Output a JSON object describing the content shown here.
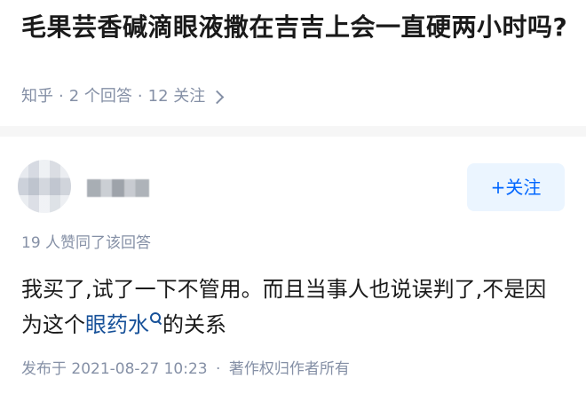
{
  "question": {
    "title": "毛果芸香碱滴眼液撒在吉吉上会一直硬两小时吗?",
    "source": "知乎",
    "answers_count": "2 个回答",
    "follows_count": "12 关注",
    "separator": "·"
  },
  "answer": {
    "follow_label": "+关注",
    "votes_text": "19 人赞同了该回答",
    "content_before_link": "我买了,试了一下不管用。而且当事人也说误判了,不是因为这个",
    "link_text": "眼药水",
    "content_after_link": "的关系",
    "published": "发布于 2021-08-27 10:23",
    "copyright": "著作权归作者所有",
    "separator": "·"
  },
  "colors": {
    "accent": "#0066ff",
    "meta_gray": "#8590a6",
    "link": "#175199",
    "follow_bg": "#ebf5ff"
  },
  "icons": [
    "chevron-right-icon",
    "search-icon"
  ]
}
